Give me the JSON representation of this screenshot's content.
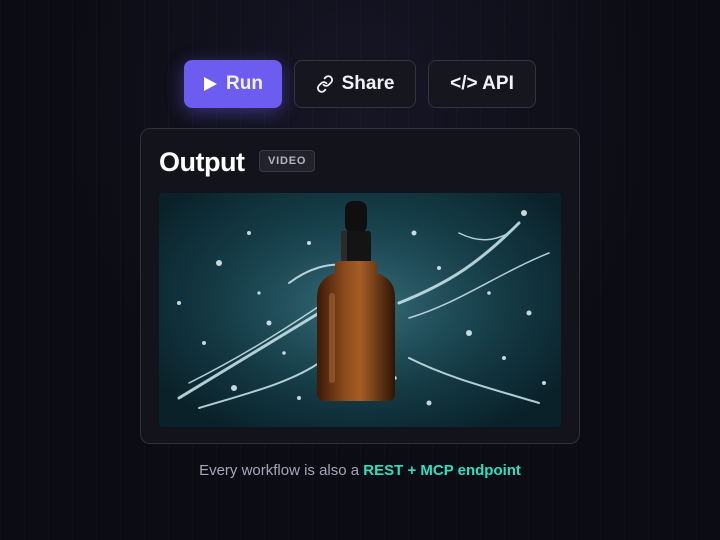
{
  "toolbar": {
    "run_label": "Run",
    "share_label": "Share",
    "api_label": "</> API",
    "run_icon": "play-icon",
    "share_icon": "link-icon"
  },
  "output": {
    "title": "Output",
    "badge": "VIDEO",
    "media_subject": "amber dropper bottle with water splash"
  },
  "caption": {
    "prefix": "Every workflow is also a ",
    "highlight": "REST + MCP endpoint"
  },
  "colors": {
    "background": "#0c0c14",
    "accent_primary": "#6c5cf0",
    "accent_highlight": "#2fe0c0",
    "card_background": "#13131c"
  }
}
